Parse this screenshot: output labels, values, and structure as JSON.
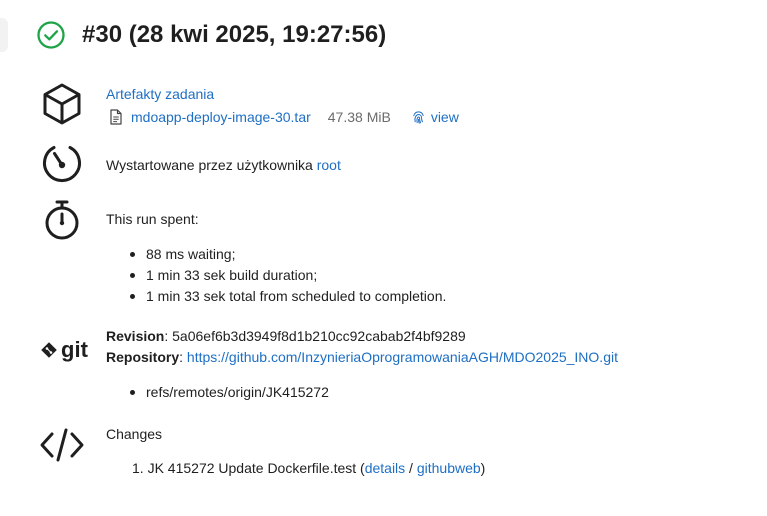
{
  "header": {
    "title": "#30 (28 kwi 2025, 19:27:56)"
  },
  "artifacts": {
    "heading": "Artefakty zadania",
    "file_name": "mdoapp-deploy-image-30.tar",
    "file_size": "47.38 MiB",
    "view_label": "view"
  },
  "started": {
    "text": "Wystartowane przez użytkownika ",
    "user": "root"
  },
  "timing": {
    "heading": "This run spent:",
    "items": [
      "88 ms waiting;",
      "1 min 33 sek build duration;",
      "1 min 33 sek total from scheduled to completion."
    ]
  },
  "git": {
    "logo_text": "git",
    "revision_label": "Revision",
    "revision_value": ": 5a06ef6b3d3949f8d1b210cc92cabab2f4bf9289",
    "repository_label": "Repository",
    "repository_sep": ": ",
    "repository_url": "https://github.com/InzynieriaOprogramowaniaAGH/MDO2025_INO.git",
    "refs": [
      "refs/remotes/origin/JK415272"
    ]
  },
  "changes": {
    "heading": "Changes",
    "item_number": "1.",
    "item_text": "JK 415272 Update Dockerfile.test (",
    "details_label": "details",
    "separator": " / ",
    "githubweb_label": "githubweb",
    "close": ")"
  },
  "colors": {
    "success": "#1ea446",
    "link": "#1e6fc4",
    "text": "#1f1f1f",
    "muted": "#6b6b6b"
  },
  "icons": {
    "status": "check-circle-icon",
    "artifacts": "package-cube-icon",
    "started": "gauge-icon",
    "timing": "stopwatch-icon",
    "scm": "git-logo-icon",
    "changes": "code-brackets-icon",
    "file": "document-icon",
    "view": "fingerprint-icon"
  }
}
